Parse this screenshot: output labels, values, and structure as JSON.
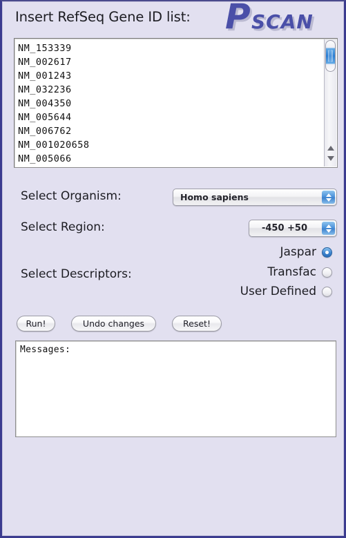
{
  "window": {
    "background_color": "#e2e0f0",
    "border_color": "#3b3b8f"
  },
  "header": {
    "title": "Insert RefSeq Gene ID list:",
    "logo": {
      "text_main": "P",
      "text_rest": "SCAN",
      "full_text": "Pscan",
      "color": "#4a4fa8"
    }
  },
  "gene_list": {
    "value": "NM_153339\nNM_002617\nNM_001243\nNM_032236\nNM_004350\nNM_005644\nNM_006762\nNM_001020658\nNM_005066",
    "ids": [
      "NM_153339",
      "NM_002617",
      "NM_001243",
      "NM_032236",
      "NM_004350",
      "NM_005644",
      "NM_006762",
      "NM_001020658",
      "NM_005066"
    ],
    "scrollbar": {
      "thumb_color": "#2e7fd4",
      "up_arrow_icon": "triangle-up-icon",
      "down_arrow_icon": "triangle-down-icon"
    }
  },
  "form": {
    "organism": {
      "label": "Select Organism:",
      "value": "Homo sapiens"
    },
    "region": {
      "label": "Select Region:",
      "value": "-450 +50"
    },
    "descriptors": {
      "label": "Select Descriptors:",
      "options": [
        {
          "label": "Jaspar",
          "selected": true
        },
        {
          "label": "Transfac",
          "selected": false
        },
        {
          "label": "User Defined",
          "selected": false
        }
      ]
    }
  },
  "buttons": {
    "run": "Run!",
    "undo": "Undo changes",
    "reset": "Reset!"
  },
  "messages": {
    "value": "Messages:"
  }
}
